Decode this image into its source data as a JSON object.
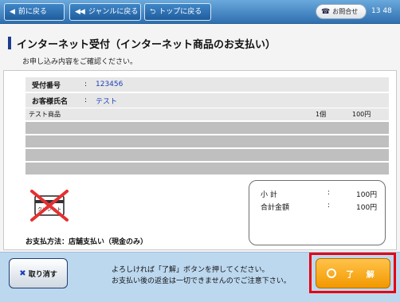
{
  "nav": {
    "back_label": "前に戻る",
    "genre_label": "ジャンルに戻る",
    "top_label": "トップに戻る",
    "inquiry_label": "お問合せ",
    "clock": "13 48"
  },
  "page": {
    "title": "インターネット受付（インターネット商品のお支払い）",
    "subtitle": "お申し込み内容をご確認ください。"
  },
  "order": {
    "receipt_label": "受付番号",
    "receipt_value": "123456",
    "customer_label": "お客様氏名",
    "customer_value": "テスト",
    "colon": ":"
  },
  "items": [
    {
      "name": "テスト商品",
      "qty": "1個",
      "price": "100円"
    }
  ],
  "payment": {
    "credit_label": "クレジット",
    "method_label": "お支払方法：店舗支払い（現金のみ）"
  },
  "totals": {
    "subtotal_label": "小 計",
    "subtotal_value": "100円",
    "total_label": "合計金額",
    "total_value": "100円",
    "colon": ":"
  },
  "footer": {
    "cancel_label": "取り消す",
    "message_line1": "よろしければ「了解」ボタンを押してください。",
    "message_line2": "お支払い後の返金は一切できませんのでご注意下さい。",
    "ok_label": "了 解"
  },
  "colors": {
    "topbar": "#2f6fb0",
    "accent_blue": "#1a3fb8",
    "ok_orange": "#f29800",
    "highlight_red": "#e60012",
    "bottom_bar": "#bcd8ef"
  }
}
